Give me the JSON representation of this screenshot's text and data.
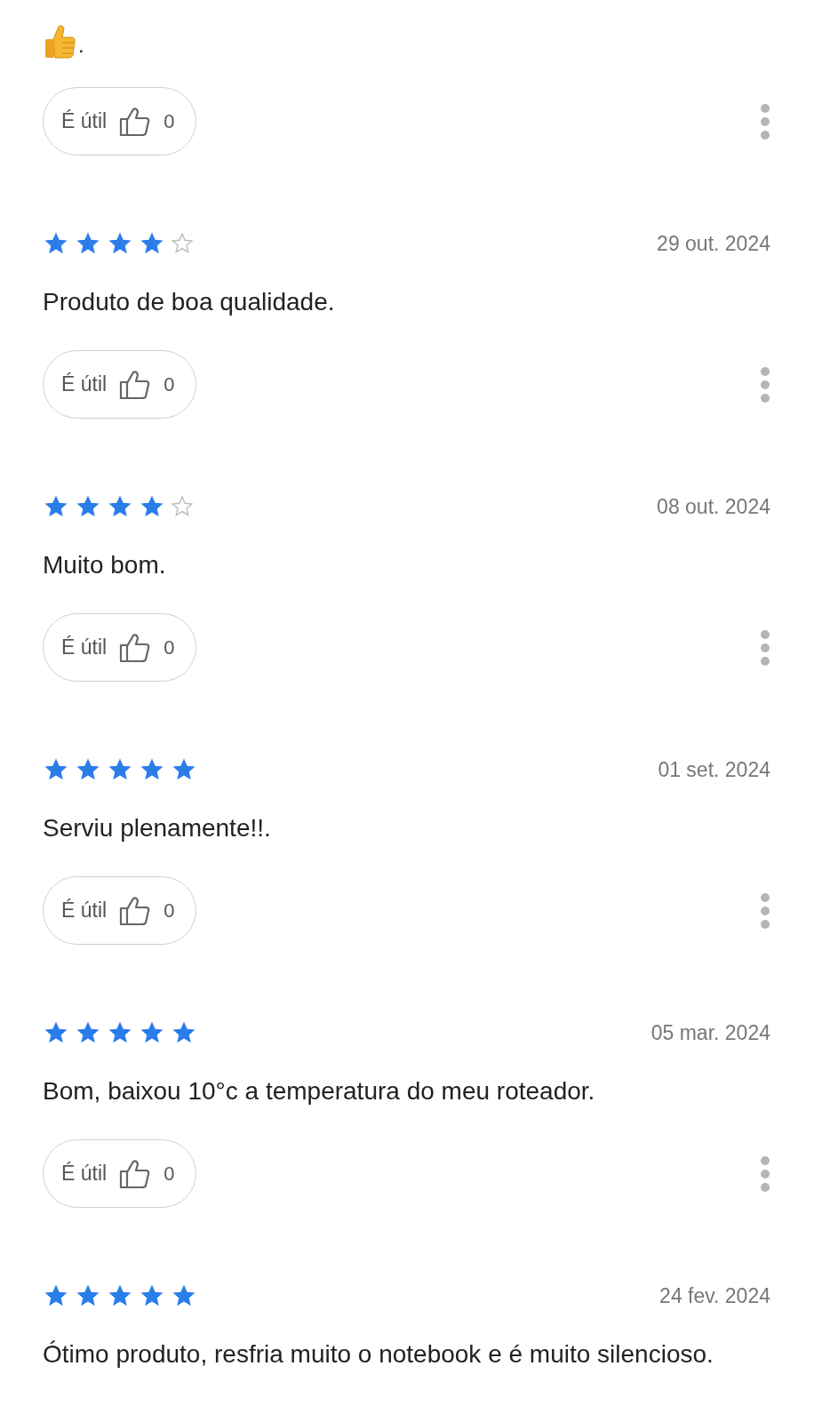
{
  "reviews": [
    {
      "kind": "emoji_text",
      "text": ".",
      "helpful": {
        "label": "É útil",
        "count": "0"
      }
    },
    {
      "kind": "rated",
      "stars": 4,
      "date": "29 out. 2024",
      "text": "Produto de boa qualidade.",
      "helpful": {
        "label": "É útil",
        "count": "0"
      }
    },
    {
      "kind": "rated",
      "stars": 4,
      "date": "08 out. 2024",
      "text": "Muito bom.",
      "helpful": {
        "label": "É útil",
        "count": "0"
      }
    },
    {
      "kind": "rated",
      "stars": 5,
      "date": "01 set. 2024",
      "text": "Serviu plenamente!!.",
      "helpful": {
        "label": "É útil",
        "count": "0"
      }
    },
    {
      "kind": "rated",
      "stars": 5,
      "date": "05 mar. 2024",
      "text": "Bom, baixou 10°c a temperatura do meu roteador.",
      "helpful": {
        "label": "É útil",
        "count": "0"
      }
    },
    {
      "kind": "rated",
      "stars": 5,
      "date": "24 fev. 2024",
      "text": "Ótimo produto, resfria muito o notebook e é muito silencioso."
    }
  ]
}
